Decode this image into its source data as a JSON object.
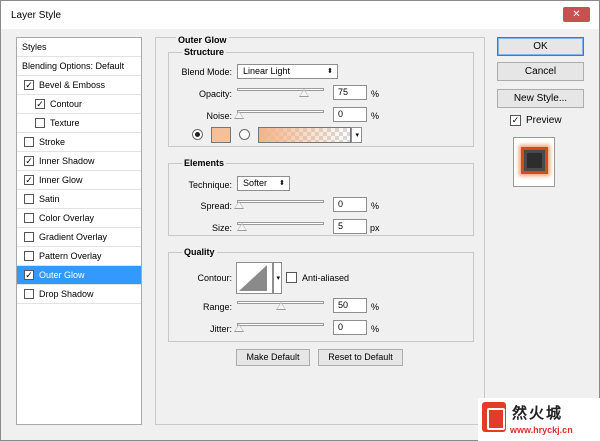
{
  "window": {
    "title": "Layer Style",
    "close_label": "✕"
  },
  "styles_panel": {
    "items": [
      {
        "label": "Styles",
        "checkbox": false,
        "checked": false,
        "indent": false,
        "selected": false
      },
      {
        "label": "Blending Options: Default",
        "checkbox": false,
        "checked": false,
        "indent": false,
        "selected": false
      },
      {
        "label": "Bevel & Emboss",
        "checkbox": true,
        "checked": true,
        "indent": false,
        "selected": false
      },
      {
        "label": "Contour",
        "checkbox": true,
        "checked": true,
        "indent": true,
        "selected": false
      },
      {
        "label": "Texture",
        "checkbox": true,
        "checked": false,
        "indent": true,
        "selected": false
      },
      {
        "label": "Stroke",
        "checkbox": true,
        "checked": false,
        "indent": false,
        "selected": false
      },
      {
        "label": "Inner Shadow",
        "checkbox": true,
        "checked": true,
        "indent": false,
        "selected": false
      },
      {
        "label": "Inner Glow",
        "checkbox": true,
        "checked": true,
        "indent": false,
        "selected": false
      },
      {
        "label": "Satin",
        "checkbox": true,
        "checked": false,
        "indent": false,
        "selected": false
      },
      {
        "label": "Color Overlay",
        "checkbox": true,
        "checked": false,
        "indent": false,
        "selected": false
      },
      {
        "label": "Gradient Overlay",
        "checkbox": true,
        "checked": false,
        "indent": false,
        "selected": false
      },
      {
        "label": "Pattern Overlay",
        "checkbox": true,
        "checked": false,
        "indent": false,
        "selected": false
      },
      {
        "label": "Outer Glow",
        "checkbox": true,
        "checked": true,
        "indent": false,
        "selected": true
      },
      {
        "label": "Drop Shadow",
        "checkbox": true,
        "checked": false,
        "indent": false,
        "selected": false
      }
    ]
  },
  "outer_glow": {
    "title": "Outer Glow",
    "structure": {
      "title": "Structure",
      "blend_mode_label": "Blend Mode:",
      "blend_mode_value": "Linear Light",
      "opacity_label": "Opacity:",
      "opacity_value": "75",
      "opacity_unit": "%",
      "noise_label": "Noise:",
      "noise_value": "0",
      "noise_unit": "%",
      "color_selected": "solid",
      "glow_color": "#f4c09a",
      "gradient_color": "#f2b48a"
    },
    "elements": {
      "title": "Elements",
      "technique_label": "Technique:",
      "technique_value": "Softer",
      "spread_label": "Spread:",
      "spread_value": "0",
      "spread_unit": "%",
      "size_label": "Size:",
      "size_value": "5",
      "size_unit": "px"
    },
    "quality": {
      "title": "Quality",
      "contour_label": "Contour:",
      "anti_aliased_label": "Anti-aliased",
      "anti_aliased_checked": false,
      "range_label": "Range:",
      "range_value": "50",
      "range_unit": "%",
      "jitter_label": "Jitter:",
      "jitter_value": "0",
      "jitter_unit": "%"
    },
    "make_default_label": "Make Default",
    "reset_default_label": "Reset to Default"
  },
  "buttons": {
    "ok": "OK",
    "cancel": "Cancel",
    "new_style": "New Style...",
    "preview_label": "Preview",
    "preview_checked": true
  },
  "watermark": {
    "title": "然火城",
    "url": "www.hryckj.cn"
  },
  "colors": {
    "selection": "#3399ff",
    "close": "#c75050",
    "glow": "#f4c09a"
  }
}
